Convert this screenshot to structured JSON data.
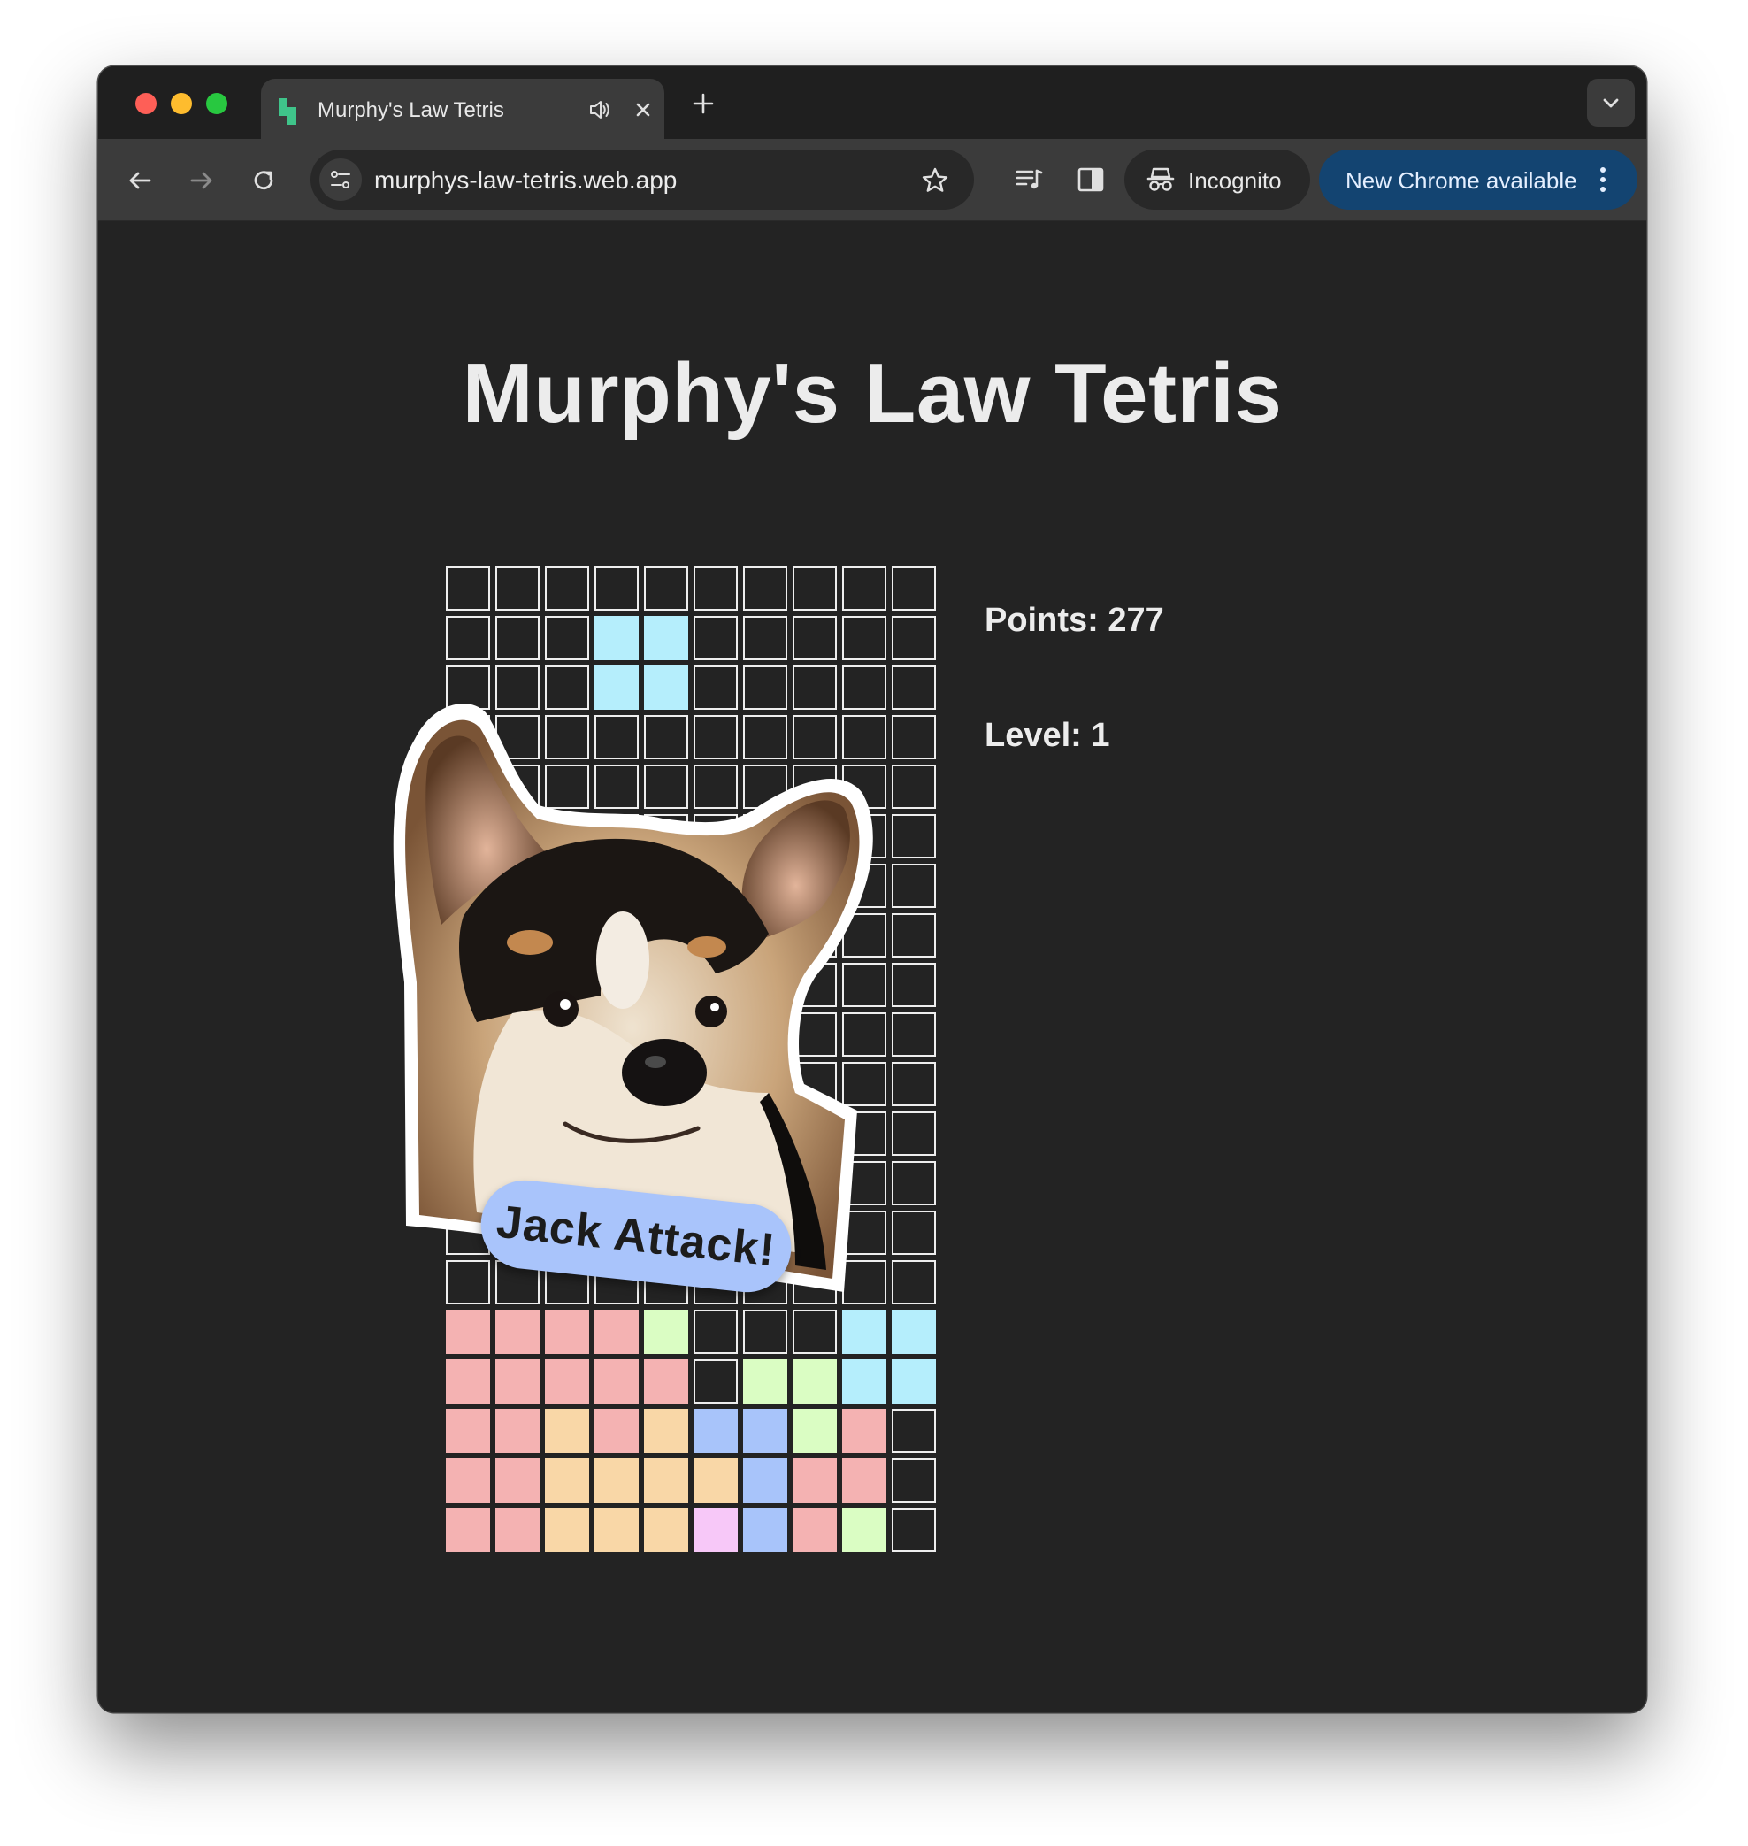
{
  "browser": {
    "tab_title": "Murphy's Law Tetris",
    "url": "murphys-law-tetris.web.app",
    "incognito_label": "Incognito",
    "update_label": "New Chrome available"
  },
  "page": {
    "title": "Murphy's Law Tetris",
    "points_label": "Points: 277",
    "level_label": "Level: 1",
    "sticker_text": "Jack Attack!"
  },
  "colors": {
    "I": "#b5eefc",
    "Z": "#f4b2b2",
    "L": "#f9d7a7",
    "S": "#dafdc3",
    "J": "#a8c4fa",
    "T": "#f7c8f8"
  },
  "board": {
    "columns": 10,
    "rows": 20,
    "grid": [
      "..........",
      "...II.....",
      "...II.....",
      "..........",
      "..........",
      "..........",
      "..........",
      "..........",
      "..........",
      "..........",
      "..........",
      "..........",
      "..........",
      "..........",
      "..........",
      "ZZZZS...II",
      "ZZZZZ.SSII",
      "ZZLZLJJSZ.",
      "ZZLLLLJZZ.",
      "ZZLLLTJZS."
    ]
  }
}
